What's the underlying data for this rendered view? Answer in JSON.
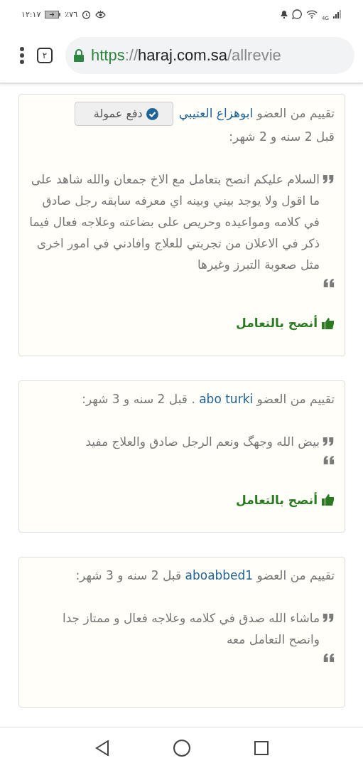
{
  "status_bar": {
    "time": "١٢:١٧",
    "battery": "٪٧٦",
    "network": "4G"
  },
  "browser": {
    "tab_count": "٢",
    "url_scheme": "https",
    "url_separator": "://",
    "url_host": "haraj.com.sa",
    "url_path": "/allrevie"
  },
  "reviews": [
    {
      "prefix": "تقييم من العضو",
      "member": "ابوهزاع العتيبي",
      "badge": {
        "label": "دفع عمولة"
      },
      "suffix": "قبل 2 سنه و 2 شهر:",
      "text": "السلام عليكم انصح بتعامل مع الاخ جمعان والله شاهد على ما اقول ولا يوجد بيني وبينه اي معرفه سابقه رجل صادق في كلامه ومواعيده وحريص على بضاعته وعلاجه فعال فيما ذكر في الاعلان من تجربتي للعلاج وافادني في امور اخرى مثل صعوبة التبرز وغيرها",
      "recommendation": "أنصح بالتعامل"
    },
    {
      "prefix": "تقييم من العضو",
      "member": "abo turki",
      "suffix": ". قبل 2 سنه و 3 شهر:",
      "text": "بيض الله وجهگ ونعم الرجل صادق والعلاج مفيد",
      "recommendation": "أنصح بالتعامل"
    },
    {
      "prefix": "تقييم من العضو",
      "member": "aboabbed1",
      "suffix": "قبل 2 سنه و 3 شهر:",
      "text": "ماشاء الله صدق في كلامه وعلاجه فعال و ممتاز جدا وانصح التعامل معه"
    }
  ]
}
